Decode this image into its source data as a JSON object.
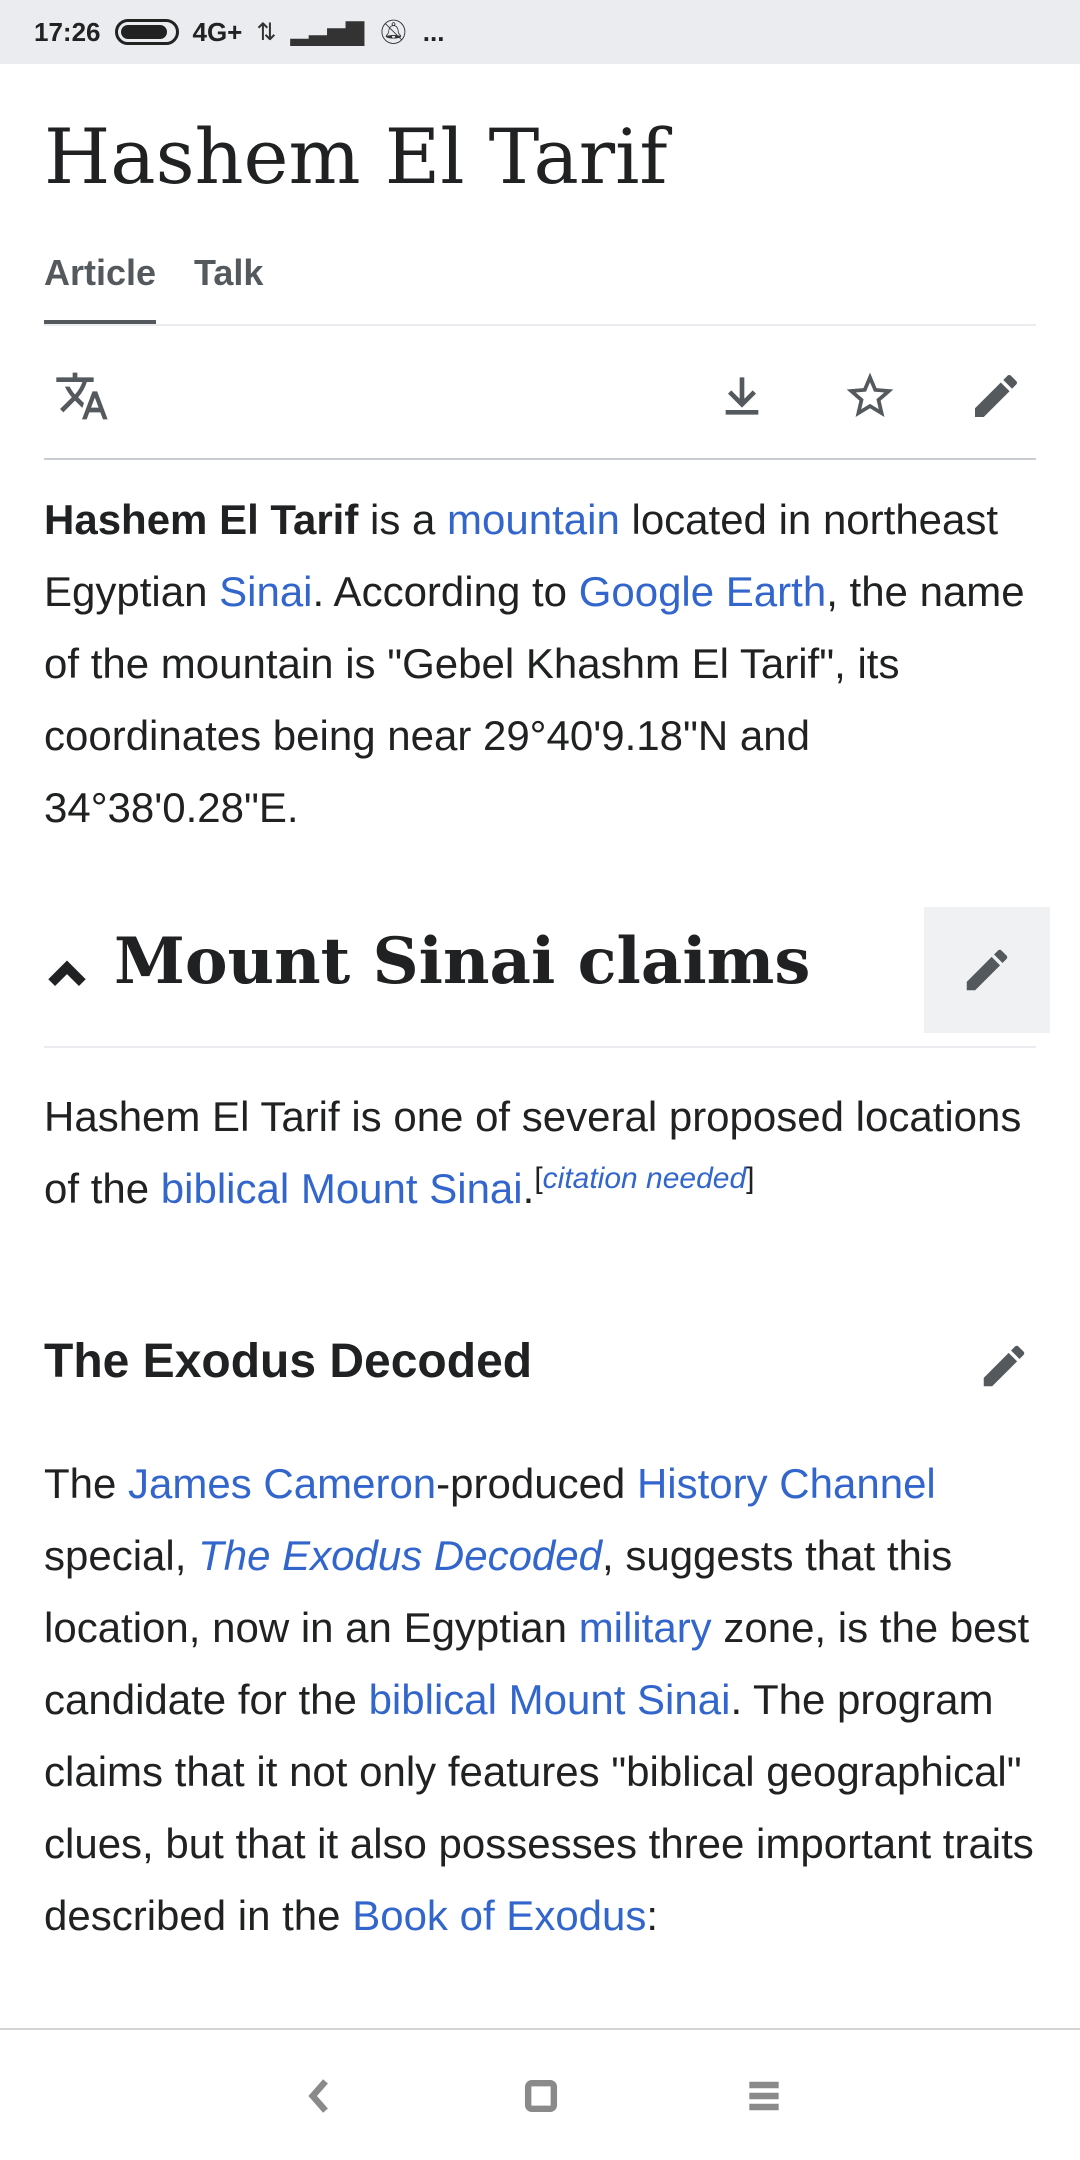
{
  "status_bar": {
    "time": "17:26",
    "network": "4G+",
    "more": "..."
  },
  "page": {
    "title": "Hashem El Tarif",
    "tabs": [
      {
        "label": "Article",
        "active": true
      },
      {
        "label": "Talk",
        "active": false
      }
    ]
  },
  "toolbar": {
    "icons": [
      "language-icon",
      "download-icon",
      "star-icon",
      "edit-icon"
    ]
  },
  "intro": {
    "bold": "Hashem El Tarif",
    "t1": " is a ",
    "link_mountain": "mountain",
    "t2": " located in northeast Egyptian ",
    "link_sinai": "Sinai",
    "t3": ". According to ",
    "link_google_earth": "Google Earth",
    "t4": ", the name of the mountain is \"Gebel Khashm El Tarif\", its coordinates being near 29°40'9.18\"N and 34°38'0.28\"E."
  },
  "section_claims": {
    "heading": "Mount Sinai claims",
    "p_t1": "Hashem El Tarif is one of several proposed locations of the ",
    "p_link": "biblical Mount Sinai",
    "p_t2": ".",
    "cite_open": "[",
    "cite_text": "citation needed",
    "cite_close": "]"
  },
  "section_exodus": {
    "heading": "The Exodus Decoded",
    "t1": "The ",
    "link_cameron": "James Cameron",
    "t2": "-produced ",
    "link_history": "History Channel",
    "t3": " special, ",
    "link_exodus_decoded": "The Exodus Decoded",
    "t4": ", suggests that this location, now in an Egyptian ",
    "link_military": "military",
    "t5": " zone, is the best candidate for the ",
    "link_sinai": "biblical Mount Sinai",
    "t6": ". The program claims that it not only features \"biblical geographical\" clues, but that it also possesses three important traits described in the ",
    "link_book": "Book of Exodus",
    "t7": ":"
  },
  "nav_bar": {
    "icons": [
      "back-icon",
      "home-icon",
      "recents-icon"
    ]
  },
  "colors": {
    "link": "#3366cc",
    "text": "#202122",
    "icon": "#54595d",
    "status_bar_bg": "#eaecf0"
  }
}
